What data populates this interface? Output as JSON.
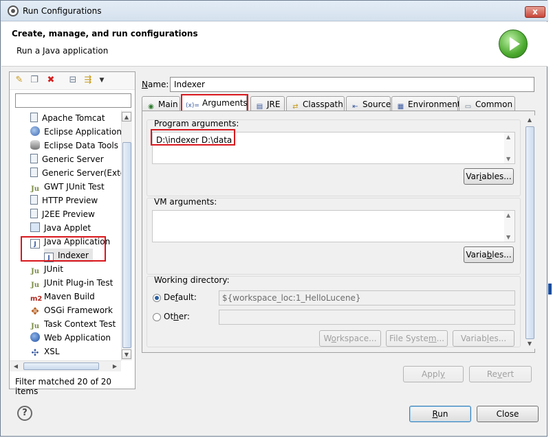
{
  "window": {
    "title": "Run Configurations",
    "close_glyph": "x"
  },
  "banner": {
    "title": "Create, manage, and run configurations",
    "subtitle": "Run a Java application",
    "icon": "run-icon"
  },
  "toolbar": {
    "icons": [
      "new-config-icon",
      "duplicate-icon",
      "delete-icon",
      "collapse-all-icon",
      "filter-icon",
      "dropdown-icon"
    ]
  },
  "filter": {
    "value": "",
    "status": "Filter matched 20 of 20 items"
  },
  "tree": {
    "items": [
      {
        "label": "Apache Tomcat",
        "icon": "tomcat-icon"
      },
      {
        "label": "Eclipse Application",
        "icon": "eclipse-icon"
      },
      {
        "label": "Eclipse Data Tools",
        "icon": "database-icon"
      },
      {
        "label": "Generic Server",
        "icon": "server-icon"
      },
      {
        "label": "Generic Server(Exte",
        "icon": "server-icon"
      },
      {
        "label": "GWT JUnit Test",
        "icon": "junit-icon"
      },
      {
        "label": "HTTP Preview",
        "icon": "server-icon"
      },
      {
        "label": "J2EE Preview",
        "icon": "server-icon"
      },
      {
        "label": "Java Applet",
        "icon": "applet-icon"
      },
      {
        "label": "Java Application",
        "icon": "java-app-icon"
      },
      {
        "label": "Indexer",
        "icon": "java-app-icon"
      },
      {
        "label": "JUnit",
        "icon": "junit-icon"
      },
      {
        "label": "JUnit Plug-in Test",
        "icon": "junit-icon"
      },
      {
        "label": "Maven Build",
        "icon": "maven-icon"
      },
      {
        "label": "OSGi Framework",
        "icon": "osgi-icon"
      },
      {
        "label": "Task Context Test",
        "icon": "junit-icon"
      },
      {
        "label": "Web Application",
        "icon": "web-app-icon"
      },
      {
        "label": "XSL",
        "icon": "xsl-icon"
      }
    ]
  },
  "config": {
    "name_label": "Name:",
    "name_value": "Indexer",
    "tabs": [
      {
        "label": "Main",
        "icon": "main-icon"
      },
      {
        "label": "Arguments",
        "icon": "arguments-icon",
        "icon_text": "(x)="
      },
      {
        "label": "JRE",
        "icon": "jre-icon"
      },
      {
        "label": "Classpath",
        "icon": "classpath-icon"
      },
      {
        "label": "Source",
        "icon": "source-icon"
      },
      {
        "label": "Environment",
        "icon": "environment-icon"
      },
      {
        "label": "Common",
        "icon": "common-icon"
      }
    ],
    "program_args_label": "Program arguments:",
    "program_args_value": "D:\\indexer D:\\data",
    "vm_args_label": "VM arguments:",
    "vm_args_value": "",
    "variables_label": "Variables...",
    "working_dir_label": "Working directory:",
    "default_label": "Default:",
    "default_value": "${workspace_loc:1_HelloLucene}",
    "other_label": "Other:",
    "other_value": "",
    "workspace_btn": "Workspace...",
    "filesystem_btn": "File System...",
    "variables_btn": "Variables..."
  },
  "actions": {
    "apply": "Apply",
    "revert": "Revert",
    "run": "Run",
    "close": "Close"
  },
  "colors": {
    "highlight": "#d9161c",
    "accent": "#3c7fb1"
  }
}
